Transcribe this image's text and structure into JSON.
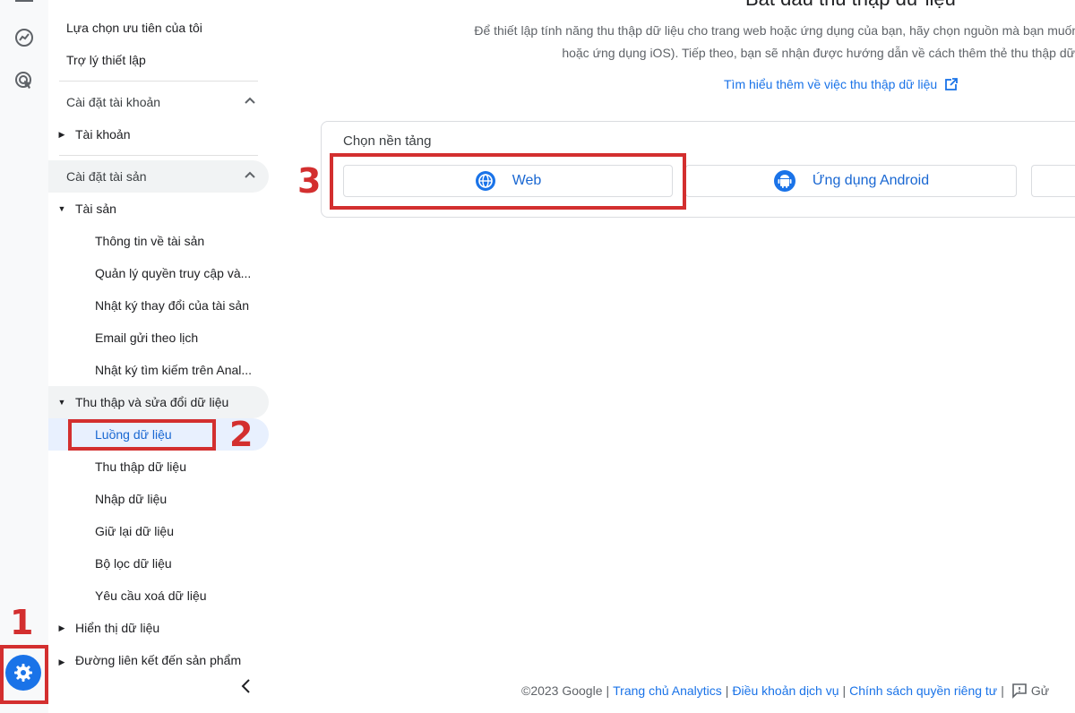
{
  "sidebar": {
    "top_items": [
      "Lựa chọn ưu tiên của tôi",
      "Trợ lý thiết lập"
    ],
    "account_section": {
      "label": "Cài đặt tài khoản",
      "items": [
        "Tài khoản"
      ]
    },
    "property_section": {
      "label": "Cài đặt tài sản",
      "group_label": "Tài sản",
      "group_items": [
        "Thông tin về tài sản",
        "Quản lý quyền truy cập và...",
        "Nhật ký thay đổi của tài sản",
        "Email gửi theo lịch",
        "Nhật ký tìm kiếm trên Anal..."
      ],
      "data_group_label": "Thu thập và sửa đổi dữ liệu",
      "data_group_items": [
        "Luồng dữ liệu",
        "Thu thập dữ liệu",
        "Nhập dữ liệu",
        "Giữ lại dữ liệu",
        "Bộ lọc dữ liệu",
        "Yêu cầu xoá dữ liệu"
      ],
      "active_item": "Luồng dữ liệu",
      "more_items": [
        "Hiển thị dữ liệu",
        "Đường liên kết đến sản phẩm"
      ]
    }
  },
  "annotations": [
    "1",
    "2",
    "3"
  ],
  "main": {
    "title": "Bắt đầu thu thập dữ liệu",
    "description_line1": "Để thiết lập tính năng thu thập dữ liệu cho trang web hoặc ứng dụng của bạn, hãy chọn nguồn mà bạn muốn t",
    "description_line2": "hoặc ứng dụng iOS). Tiếp theo, bạn sẽ nhận được hướng dẫn về cách thêm thẻ thu thập dữ",
    "learn_more": "Tìm hiểu thêm về việc thu thập dữ liệu",
    "platform_card": {
      "title": "Chọn nền tảng",
      "buttons": [
        "Web",
        "Ứng dụng Android"
      ]
    }
  },
  "footer": {
    "copyright": "©2023 Google",
    "links": [
      "Trang chủ Analytics",
      "Điều khoản dịch vụ",
      "Chính sách quyền riêng tư"
    ],
    "feedback": "Gử"
  },
  "colors": {
    "accent": "#1a73e8",
    "active_text": "#1967d2",
    "annotation": "#d32f2f"
  }
}
